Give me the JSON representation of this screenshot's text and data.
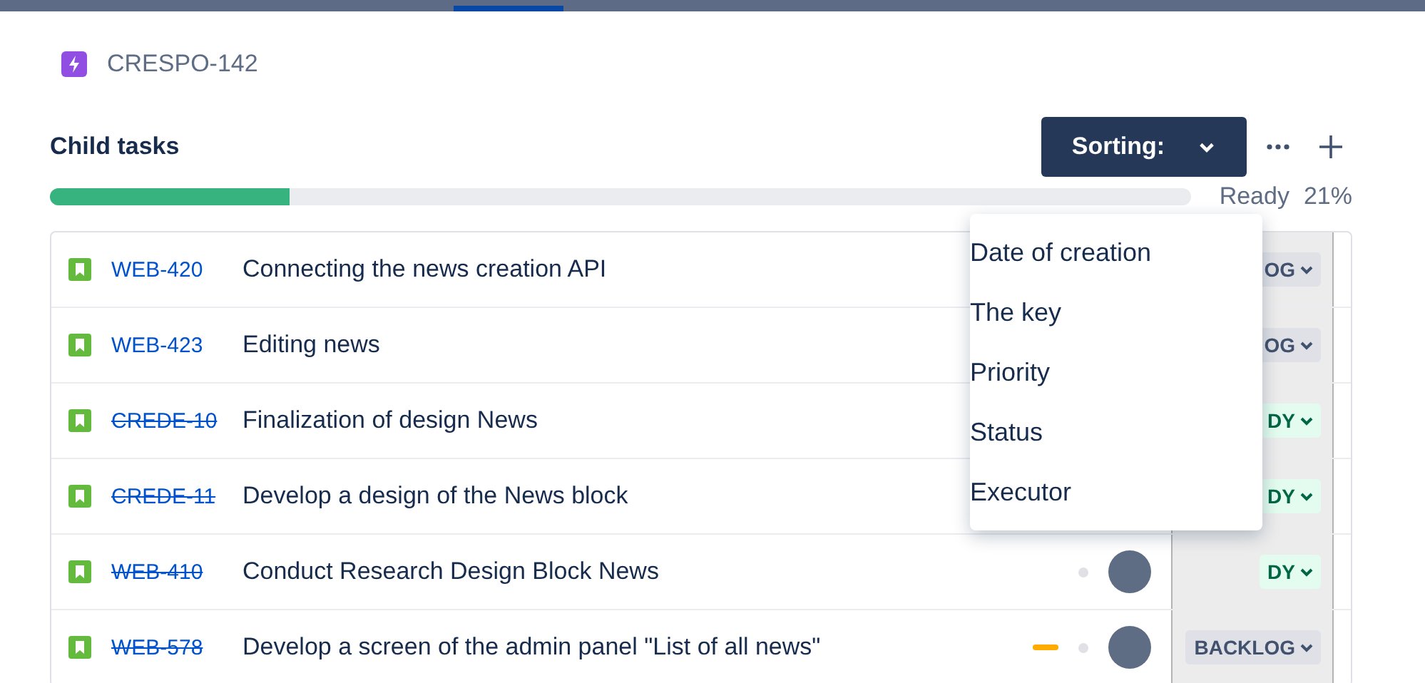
{
  "issue": {
    "key": "CRESPO-142"
  },
  "child_tasks": {
    "title": "Child tasks",
    "sort_button": {
      "label": "Sorting:"
    },
    "progress": {
      "level": 0.21,
      "label": "Ready",
      "percent": "21%"
    }
  },
  "rows": [
    {
      "key": "WEB-420",
      "done": false,
      "title": "Connecting the news creation API",
      "status": "OG",
      "kind": "backlog"
    },
    {
      "key": "WEB-423",
      "done": false,
      "title": "Editing news",
      "status": "OG",
      "kind": "backlog"
    },
    {
      "key": "CREDE-10",
      "done": true,
      "title": "Finalization of design News",
      "status": "DY",
      "kind": "ready"
    },
    {
      "key": "CREDE-11",
      "done": true,
      "title": "Develop a design of the News block",
      "status": "DY",
      "kind": "ready"
    },
    {
      "key": "WEB-410",
      "done": true,
      "title": "Conduct Research Design Block News",
      "status": "DY",
      "kind": "ready",
      "assignee": true,
      "priority_marker": false
    },
    {
      "key": "WEB-578",
      "done": true,
      "title": "Develop a screen of the admin panel \"List of all news\"",
      "status": "BACKLOG",
      "kind": "backlog",
      "assignee": true,
      "priority_marker": true
    }
  ],
  "sort_menu": {
    "items": [
      "Date of creation",
      "The key",
      "Priority",
      "Status",
      "Executor"
    ]
  }
}
